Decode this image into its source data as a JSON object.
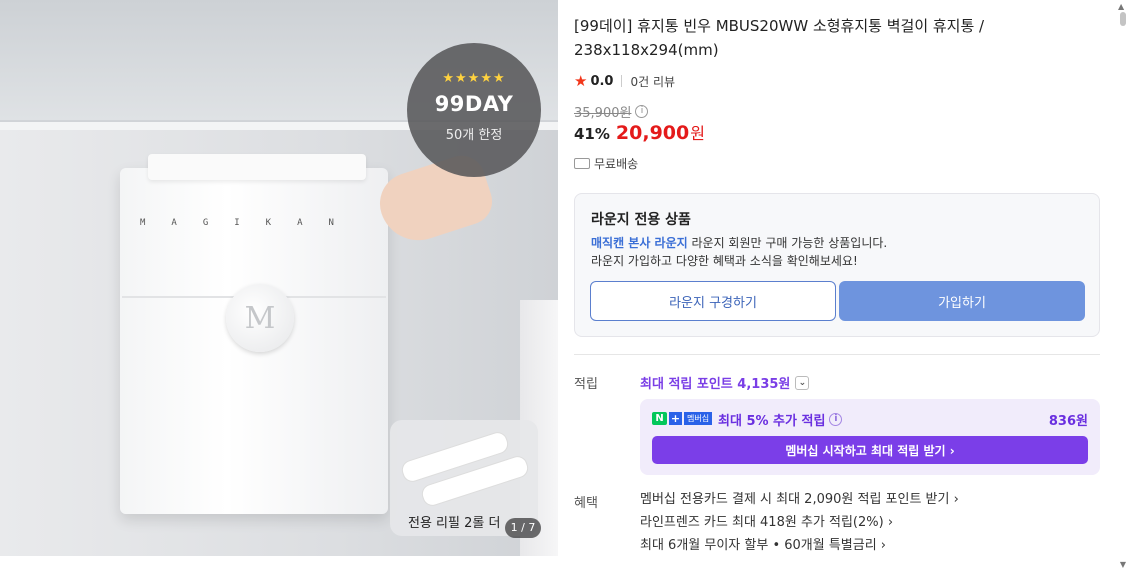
{
  "product": {
    "title": "[99데이] 휴지통 빈우 MBUS20WW 소형휴지통 벽걸이 휴지통 / 238x118x294(mm)",
    "rating": "0.0",
    "review_count": "0건 리뷰",
    "original_price": "35,900원",
    "discount": "41%",
    "sale_price": "20,900",
    "currency": "원",
    "shipping": "무료배송"
  },
  "gallery": {
    "badge_stars": "★★★★★",
    "badge_title": "99DAY",
    "badge_subtitle": "50개 한정",
    "brand_text": "MAGIKAN",
    "knob_letter": "M",
    "thumb_label": "전용 리필 2롤 더",
    "counter": "1 / 7"
  },
  "lounge": {
    "title": "라운지 전용 상품",
    "desc_link": "매직캔 본사 라운지",
    "desc1_rest": " 라운지 회원만 구매 가능한 상품입니다.",
    "desc2": "라운지 가입하고 다양한 혜택과 소식을 확인해보세요!",
    "browse_button": "라운지 구경하기",
    "join_button": "가입하기"
  },
  "points": {
    "label": "적립",
    "max_text": "최대 적립 포인트 4,135원",
    "member_logo_n": "N",
    "member_logo_plus": "+",
    "member_logo_tag": "멤버십",
    "member_extra": "최대 5% 추가 적립",
    "member_amount": "836원",
    "member_button": "멤버십 시작하고 최대 적립 받기 ›"
  },
  "benefits": {
    "label": "혜택",
    "items": [
      "멤버십 전용카드 결제 시 최대 2,090원 적립 포인트 받기 ›",
      "라인프렌즈 카드 최대 418원 추가 적립(2%) ›",
      "최대 6개월 무이자 할부 • 60개월 특별금리 ›"
    ]
  },
  "colors": {
    "sale_red": "#e41a1a",
    "member_purple": "#7b3ee8",
    "lounge_blue": "#6e94de"
  }
}
